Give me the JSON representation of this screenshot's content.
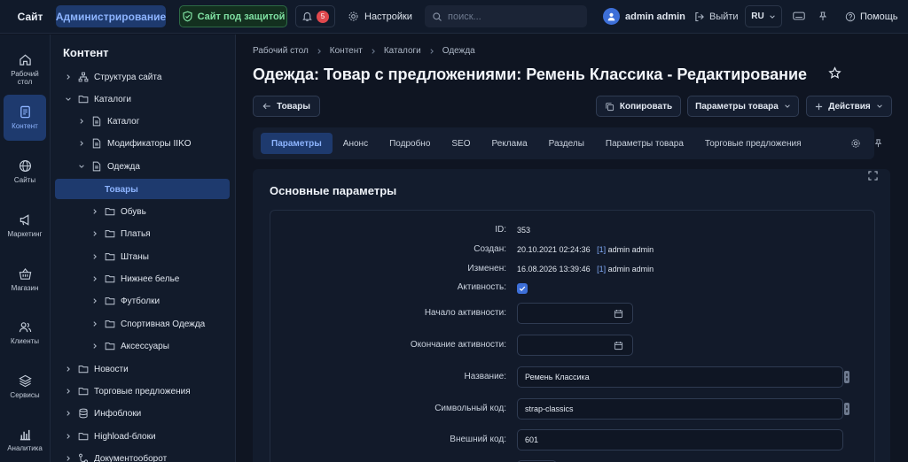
{
  "topbar": {
    "site_label": "Сайт",
    "admin_label": "Администрирование",
    "protect_label": "Сайт под защитой",
    "notifications_count": "5",
    "settings_label": "Настройки",
    "search_placeholder": "поиск...",
    "user_name": "admin admin",
    "logout_label": "Выйти",
    "lang_label": "RU",
    "help_label": "Помощь"
  },
  "rail": {
    "items": [
      {
        "label": "Рабочий стол"
      },
      {
        "label": "Контент"
      },
      {
        "label": "Сайты"
      },
      {
        "label": "Маркетинг"
      },
      {
        "label": "Магазин"
      },
      {
        "label": "Клиенты"
      },
      {
        "label": "Сервисы"
      },
      {
        "label": "Аналитика"
      }
    ]
  },
  "tree": {
    "title": "Контент",
    "items": [
      {
        "label": "Структура сайта"
      },
      {
        "label": "Каталоги"
      },
      {
        "label": "Каталог"
      },
      {
        "label": "Модификаторы IIKO"
      },
      {
        "label": "Одежда"
      },
      {
        "label": "Товары"
      },
      {
        "label": "Обувь"
      },
      {
        "label": "Платья"
      },
      {
        "label": "Штаны"
      },
      {
        "label": "Нижнее белье"
      },
      {
        "label": "Футболки"
      },
      {
        "label": "Спортивная Одежда"
      },
      {
        "label": "Аксессуары"
      },
      {
        "label": "Новости"
      },
      {
        "label": "Торговые предложения"
      },
      {
        "label": "Инфоблоки"
      },
      {
        "label": "Highload-блоки"
      },
      {
        "label": "Документооборот"
      }
    ]
  },
  "breadcrumb": [
    "Рабочий стол",
    "Контент",
    "Каталоги",
    "Одежда"
  ],
  "page_title": "Одежда: Товар с предложениями: Ремень Классика - Редактирование",
  "toolbar": {
    "back_label": "Товары",
    "copy_label": "Копировать",
    "params_label": "Параметры товара",
    "actions_label": "Действия"
  },
  "tabs": [
    "Параметры",
    "Анонс",
    "Подробно",
    "SEO",
    "Реклама",
    "Разделы",
    "Параметры товара",
    "Торговые предложения"
  ],
  "form": {
    "section_title": "Основные параметры",
    "id_label": "ID:",
    "id_value": "353",
    "created_label": "Создан:",
    "created_value": "20.10.2021 02:24:36",
    "created_user_id": "[1]",
    "created_user": "admin admin",
    "modified_label": "Изменен:",
    "modified_value": "16.08.2026 13:39:46",
    "modified_user_id": "[1]",
    "modified_user": "admin admin",
    "active_label": "Активность:",
    "active_from_label": "Начало активности:",
    "active_to_label": "Окончание активности:",
    "name_label": "Название:",
    "name_value": "Ремень Классика",
    "code_label": "Символьный код:",
    "code_value": "strap-classics",
    "xml_label": "Внешний код:",
    "xml_value": "601"
  },
  "colors": {
    "accent": "#3d6fd8",
    "active_bg": "#1e3a6e",
    "protect": "#7fe0a2",
    "badge": "#e0484d"
  }
}
